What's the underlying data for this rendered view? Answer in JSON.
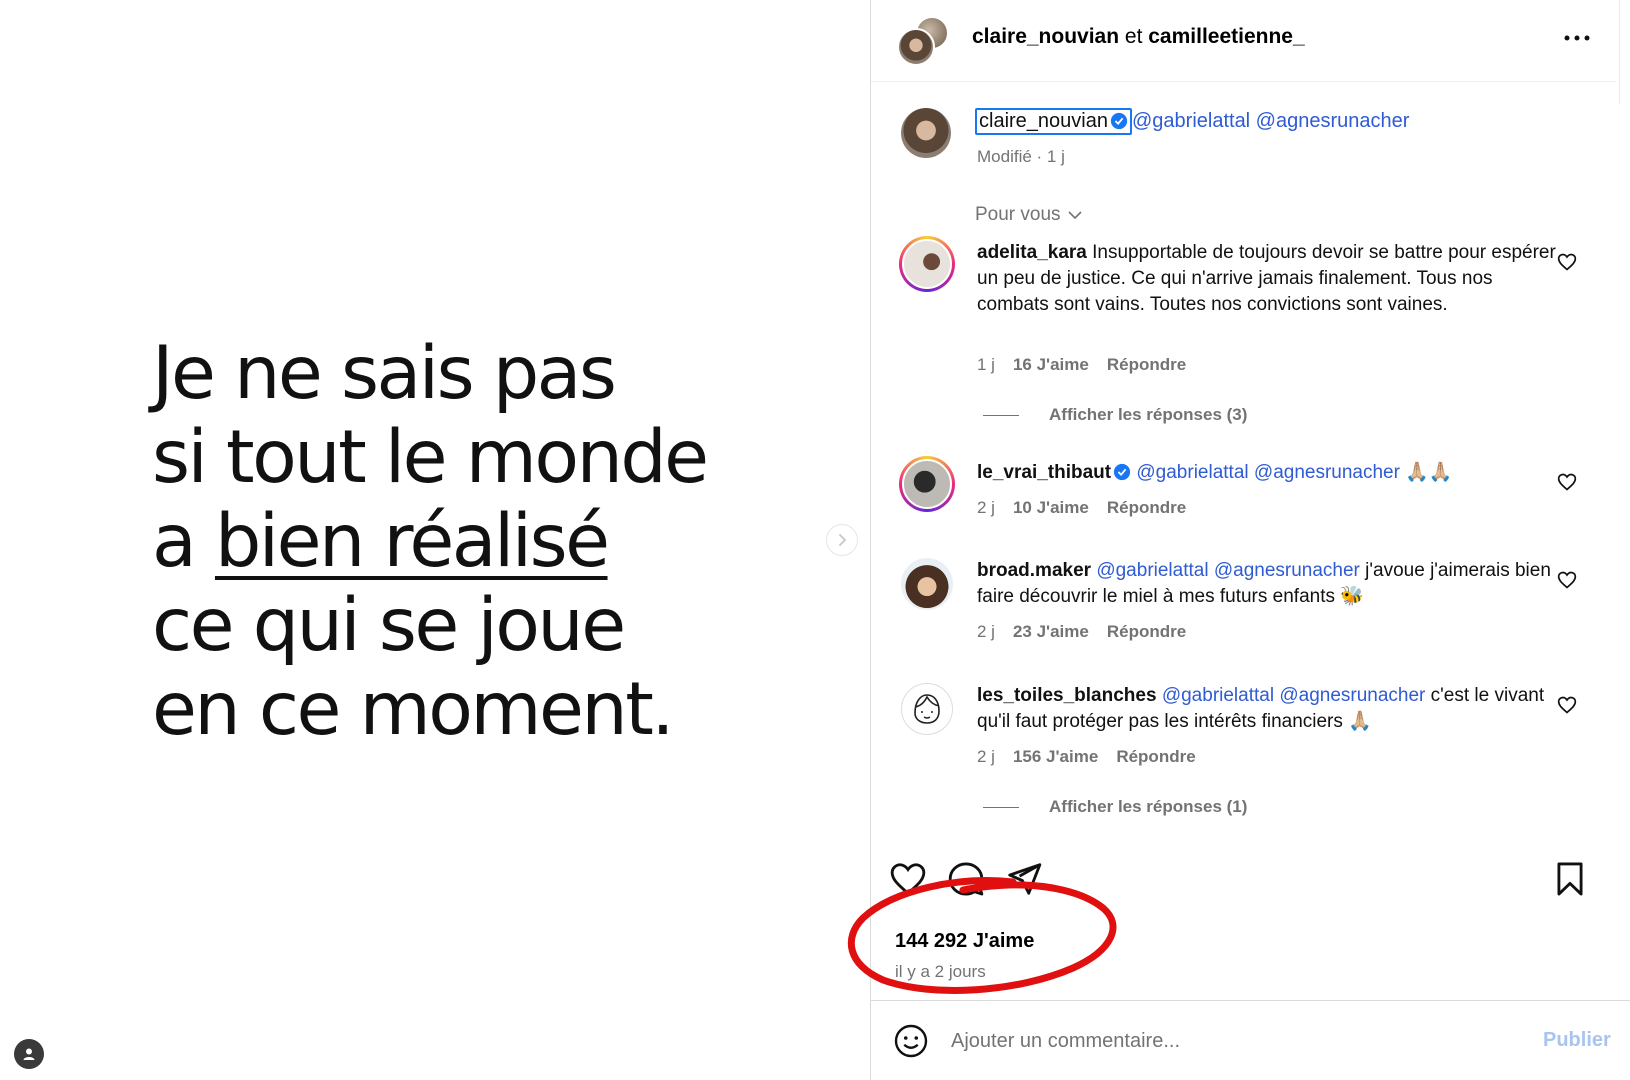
{
  "post": {
    "quote_lines": [
      "Je ne sais pas",
      "si tout le monde",
      "a",
      "bien réalisé",
      "ce qui se joue",
      "en ce moment."
    ]
  },
  "header": {
    "user1": "claire_nouvian",
    "joiner": " et ",
    "user2": "camilleetienne_"
  },
  "caption": {
    "username": "claire_nouvian",
    "mentions": "@gabrielattal @agnesrunacher",
    "meta": "Modifié · 1 j"
  },
  "sort": {
    "label": "Pour vous"
  },
  "comments": [
    {
      "username": "adelita_kara",
      "text": "Insupportable de toujours devoir se battre pour espérer un peu de justice. Ce qui n'arrive jamais finalement. Tous nos combats sont vains. Toutes nos convictions sont vaines.",
      "time": "1 j",
      "likes": "16 J'aime",
      "reply": "Répondre",
      "replies": "Afficher les réponses (3)"
    },
    {
      "username": "le_vrai_thibaut",
      "text": "@gabrielattal @agnesrunacher 🙏🏼🙏🏼",
      "time": "2 j",
      "likes": "10 J'aime",
      "reply": "Répondre"
    },
    {
      "username": "broad.maker",
      "mentions": "@gabrielattal @agnesrunacher",
      "text": "j'avoue j'aimerais bien faire découvrir le miel à mes futurs enfants 🐝",
      "time": "2 j",
      "likes": "23 J'aime",
      "reply": "Répondre"
    },
    {
      "username": "les_toiles_blanches",
      "mentions": "@gabrielattal @agnesrunacher",
      "text": "c'est le vivant qu'il faut protéger pas les intérêts financiers 🙏🏼",
      "time": "2 j",
      "likes": "156 J'aime",
      "reply": "Répondre",
      "replies": "Afficher les réponses (1)"
    }
  ],
  "footer": {
    "likes": "144 292 J'aime",
    "ago": "il y a 2 jours",
    "comment_placeholder": "Ajouter un commentaire...",
    "publish": "Publier"
  },
  "icons": [
    "heart-icon",
    "comment-icon",
    "share-icon",
    "bookmark-icon",
    "emoji-icon",
    "more-icon",
    "chevron-right-icon",
    "chevron-down-icon",
    "verified-icon",
    "account-icon"
  ],
  "colors": {
    "mention": "#2f5bd3",
    "verified": "#1877f2",
    "annotation": "#e01010"
  }
}
